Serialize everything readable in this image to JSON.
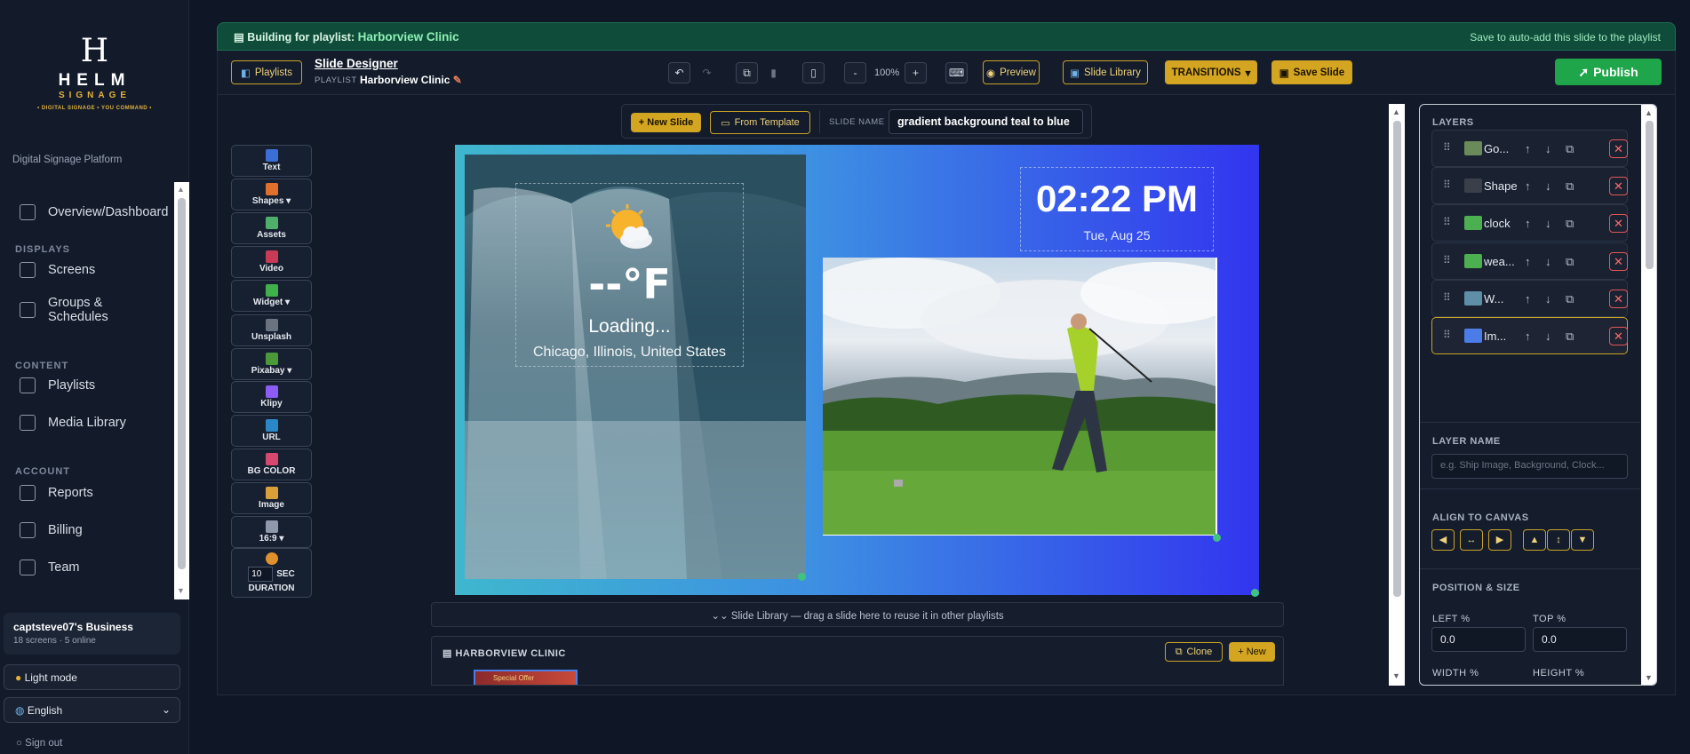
{
  "sidebar": {
    "logo_letter": "H",
    "logo_name": "HELM",
    "logo_sub": "SIGNAGE",
    "logo_tagline": "• DIGITAL SIGNAGE • YOU COMMAND •",
    "platform_label": "Digital Signage Platform",
    "items": [
      {
        "label": "Overview/Dashboard",
        "icon": "dashboard-icon"
      },
      {
        "section": "DISPLAYS"
      },
      {
        "label": "Screens",
        "icon": "monitor-icon"
      },
      {
        "label": "Groups & Schedules",
        "icon": "calendar-icon"
      },
      {
        "section": "CONTENT"
      },
      {
        "label": "Playlists",
        "icon": "list-icon"
      },
      {
        "label": "Media Library",
        "icon": "image-icon"
      },
      {
        "section": "ACCOUNT"
      },
      {
        "label": "Reports",
        "icon": "chart-icon"
      },
      {
        "label": "Billing",
        "icon": "card-icon"
      },
      {
        "label": "Team",
        "icon": "team-icon"
      }
    ],
    "business_name": "captsteve07's Business",
    "business_status": "18 screens · 5 online",
    "theme_button": "Light mode",
    "language": "English",
    "signout": "Sign out"
  },
  "banner": {
    "prefix": "Building for playlist:",
    "playlist": "Harborview Clinic",
    "hint": "Save to auto-add this slide to the playlist"
  },
  "toolbar": {
    "playlists_btn": "Playlists",
    "title": "Slide Designer",
    "playlist_label": "PLAYLIST",
    "playlist_name": "Harborview Clinic",
    "zoom": "100%",
    "zoom_out": "-",
    "zoom_in": "+",
    "preview": "Preview",
    "slide_library": "Slide Library",
    "transitions": "TRANSITIONS",
    "save_slide": "Save Slide",
    "publish": "Publish"
  },
  "slidebar": {
    "new_slide": "+ New Slide",
    "from_template": "From Template",
    "name_label": "SLIDE NAME",
    "name_value": "gradient background teal to blue"
  },
  "tools": [
    {
      "label": "Text",
      "icon": "text-icon",
      "color": "#3b6fd6"
    },
    {
      "label": "Shapes ▾",
      "icon": "shapes-icon",
      "color": "#e0702c"
    },
    {
      "label": "Assets",
      "icon": "assets-icon",
      "color": "#4fae6a"
    },
    {
      "label": "Video",
      "icon": "video-icon",
      "color": "#c83a55"
    },
    {
      "label": "Widget ▾",
      "icon": "puzzle-icon",
      "color": "#3fb04a"
    },
    {
      "label": "Unsplash",
      "icon": "camera-icon",
      "color": "#6b7383"
    },
    {
      "label": "Pixabay ▾",
      "icon": "pixabay-icon",
      "color": "#4a9a3a"
    },
    {
      "label": "Klipy",
      "icon": "klipy-icon",
      "color": "#8b5cf6"
    },
    {
      "label": "URL",
      "icon": "globe-icon",
      "color": "#2a88c9"
    },
    {
      "label": "BG COLOR",
      "icon": "palette-icon",
      "color": "#d6486d"
    },
    {
      "label": "Image",
      "icon": "image-icon",
      "color": "#d9a03a"
    },
    {
      "label": "16:9 ▾",
      "icon": "aspect-icon",
      "color": "#8e99ab"
    }
  ],
  "duration": {
    "value": "10",
    "unit": "SEC",
    "label": "DURATION"
  },
  "canvas": {
    "weather_temp": "--°F",
    "weather_status": "Loading...",
    "weather_location": "Chicago, Illinois, United States",
    "clock_time": "02:22 PM",
    "clock_date": "Tue, Aug 25"
  },
  "library_bar": "Slide Library — drag a slide here to reuse it in other playlists",
  "playlist_strip": {
    "title": "HARBORVIEW CLINIC",
    "clone": "Clone",
    "new": "+ New",
    "thumb_text": "Special Offer"
  },
  "layers_panel": {
    "title": "LAYERS",
    "layers": [
      {
        "name": "Go...",
        "thumb": "#6a8a5a"
      },
      {
        "name": "Shape",
        "thumb": "#3a3f4a"
      },
      {
        "name": "clock",
        "thumb": "#4caf50"
      },
      {
        "name": "wea...",
        "thumb": "#4caf50"
      },
      {
        "name": "W...",
        "thumb": "#5e8fa6"
      },
      {
        "name": "Im...",
        "thumb": "#4a7de8"
      }
    ],
    "layer_name_label": "LAYER NAME",
    "layer_name_placeholder": "e.g. Ship Image, Background, Clock...",
    "align_label": "ALIGN TO CANVAS",
    "pos_label": "POSITION & SIZE",
    "left_label": "LEFT %",
    "top_label": "TOP %",
    "left_value": "0.0",
    "top_value": "0.0",
    "width_label": "WIDTH %",
    "height_label": "HEIGHT %"
  }
}
